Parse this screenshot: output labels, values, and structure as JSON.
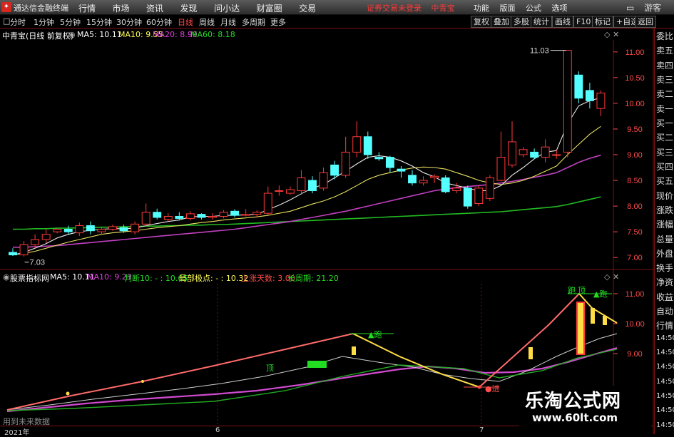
{
  "app": {
    "title": "通达信金融终端",
    "menu": [
      "行情",
      "市场",
      "资讯",
      "发现",
      "问小达",
      "财富圈",
      "交易"
    ],
    "notice": [
      "证券交易未登录",
      "中青宝"
    ],
    "right_menu": [
      "功能",
      "版面",
      "公式",
      "选项"
    ],
    "window_controls": [
      "游客"
    ]
  },
  "periods": {
    "items": [
      "分时",
      "1分钟",
      "5分钟",
      "15分钟",
      "30分钟",
      "60分钟",
      "日线",
      "周线",
      "月线",
      "多周期",
      "更多"
    ],
    "selected": "日线",
    "right_buttons": [
      "复权",
      "叠加",
      "多股",
      "统计",
      "画线",
      "F10",
      "标记",
      "+自选",
      "返回"
    ]
  },
  "main_chart": {
    "stock": "中青宝(日线 前复权)",
    "ma_labels": [
      {
        "text": "MA5: 10.11",
        "color": "#ffffff"
      },
      {
        "text": "MA10: 9.55",
        "color": "#ffff55"
      },
      {
        "text": "MA20: 8.99",
        "color": "#e040e0"
      },
      {
        "text": "MA60: 8.18",
        "color": "#22dd22"
      }
    ],
    "high_label": "11.03",
    "low_label": "7.03"
  },
  "sub_chart": {
    "indicator": "股票指标网",
    "labels": [
      {
        "text": "MA5: 10.11",
        "color": "#ffffff"
      },
      {
        "text": "MA10: 9.23",
        "color": "#e040e0"
      },
      {
        "text": "判断10: - : 10.65",
        "color": "#22dd22"
      },
      {
        "text": "局部极点: - : 10.32",
        "color": "#ffff55"
      },
      {
        "text": "上涨天数: 3.00",
        "color": "#ff4b4b"
      },
      {
        "text": "长周期: 21.20",
        "color": "#22dd22"
      }
    ],
    "marks": [
      {
        "text": "顶",
        "color": "#22dd22"
      },
      {
        "text": "▲跑",
        "color": "#22dd22"
      },
      {
        "text": "顶",
        "color": "#22dd22"
      },
      {
        "text": "跑",
        "color": "#22dd22"
      },
      {
        "text": "▲跑",
        "color": "#22dd22"
      },
      {
        "text": "●进",
        "color": "#ff4b4b"
      }
    ],
    "note": "用到未来数据"
  },
  "right_panel": {
    "items": [
      "委比",
      "卖五",
      "卖四",
      "卖三",
      "卖二",
      "卖一",
      "买一",
      "买二",
      "买三",
      "买四",
      "买五",
      "现价",
      "涨跌",
      "涨幅",
      "总量",
      "外盘",
      "换手",
      "净资",
      "收益",
      "自动",
      "行情",
      "14:50",
      "14:50",
      "14:50",
      "14:50",
      "14:50",
      "14:50",
      "14:50"
    ]
  },
  "dates": [
    "2021年",
    "6",
    "7"
  ],
  "watermark": {
    "line1": "乐淘公式网",
    "line2": "www.60lt.com"
  },
  "chart_data": {
    "type": "candlestick",
    "title": "中青宝(日线 前复权)",
    "ylim": [
      6.85,
      11.15
    ],
    "y_ticks": [
      7.0,
      7.5,
      8.0,
      8.5,
      9.0,
      9.5,
      10.0,
      10.5,
      11.0
    ],
    "candles": [
      {
        "o": 7.1,
        "c": 7.05,
        "h": 7.18,
        "l": 7.03
      },
      {
        "o": 7.05,
        "c": 7.25,
        "h": 7.32,
        "l": 7.02
      },
      {
        "o": 7.25,
        "c": 7.35,
        "h": 7.45,
        "l": 7.18
      },
      {
        "o": 7.35,
        "c": 7.45,
        "h": 7.55,
        "l": 7.28
      },
      {
        "o": 7.5,
        "c": 7.55,
        "h": 7.58,
        "l": 7.47
      },
      {
        "o": 7.55,
        "c": 7.5,
        "h": 7.62,
        "l": 7.45
      },
      {
        "o": 7.48,
        "c": 7.62,
        "h": 7.68,
        "l": 7.42
      },
      {
        "o": 7.62,
        "c": 7.52,
        "h": 7.7,
        "l": 7.45
      },
      {
        "o": 7.5,
        "c": 7.55,
        "h": 7.6,
        "l": 7.45
      },
      {
        "o": 7.55,
        "c": 7.6,
        "h": 7.64,
        "l": 7.52
      },
      {
        "o": 7.58,
        "c": 7.52,
        "h": 7.64,
        "l": 7.48
      },
      {
        "o": 7.5,
        "c": 7.65,
        "h": 7.7,
        "l": 7.45
      },
      {
        "o": 7.65,
        "c": 7.88,
        "h": 8.05,
        "l": 7.6
      },
      {
        "o": 7.88,
        "c": 7.78,
        "h": 7.95,
        "l": 7.74
      },
      {
        "o": 7.74,
        "c": 7.8,
        "h": 7.86,
        "l": 7.7
      },
      {
        "o": 7.8,
        "c": 7.76,
        "h": 7.88,
        "l": 7.72
      },
      {
        "o": 7.76,
        "c": 7.85,
        "h": 7.9,
        "l": 7.72
      },
      {
        "o": 7.84,
        "c": 7.78,
        "h": 7.86,
        "l": 7.74
      },
      {
        "o": 7.78,
        "c": 7.8,
        "h": 7.86,
        "l": 7.74
      },
      {
        "o": 7.8,
        "c": 7.88,
        "h": 7.92,
        "l": 7.76
      },
      {
        "o": 7.9,
        "c": 7.82,
        "h": 7.94,
        "l": 7.78
      },
      {
        "o": 7.82,
        "c": 7.84,
        "h": 7.94,
        "l": 7.8
      },
      {
        "o": 7.84,
        "c": 7.88,
        "h": 7.92,
        "l": 7.78
      },
      {
        "o": 7.86,
        "c": 8.25,
        "h": 8.38,
        "l": 7.82
      },
      {
        "o": 8.3,
        "c": 8.3,
        "h": 8.4,
        "l": 8.2
      },
      {
        "o": 8.25,
        "c": 8.32,
        "h": 8.38,
        "l": 8.22
      },
      {
        "o": 8.3,
        "c": 8.55,
        "h": 8.7,
        "l": 8.22
      },
      {
        "o": 8.5,
        "c": 8.3,
        "h": 8.58,
        "l": 8.25
      },
      {
        "o": 8.35,
        "c": 8.65,
        "h": 8.75,
        "l": 8.3
      },
      {
        "o": 8.8,
        "c": 8.6,
        "h": 8.88,
        "l": 8.52
      },
      {
        "o": 8.6,
        "c": 9.05,
        "h": 9.35,
        "l": 8.55
      },
      {
        "o": 9.05,
        "c": 9.35,
        "h": 9.65,
        "l": 8.95
      },
      {
        "o": 9.35,
        "c": 9.0,
        "h": 9.45,
        "l": 8.92
      },
      {
        "o": 8.95,
        "c": 8.92,
        "h": 9.05,
        "l": 8.88
      },
      {
        "o": 8.95,
        "c": 8.75,
        "h": 8.98,
        "l": 8.65
      },
      {
        "o": 8.72,
        "c": 8.68,
        "h": 8.78,
        "l": 8.55
      },
      {
        "o": 8.6,
        "c": 8.45,
        "h": 8.7,
        "l": 8.4
      },
      {
        "o": 8.45,
        "c": 8.5,
        "h": 8.58,
        "l": 8.4
      },
      {
        "o": 8.55,
        "c": 8.58,
        "h": 8.62,
        "l": 8.45
      },
      {
        "o": 8.55,
        "c": 8.28,
        "h": 8.6,
        "l": 8.25
      },
      {
        "o": 8.3,
        "c": 8.35,
        "h": 8.45,
        "l": 8.25
      },
      {
        "o": 8.35,
        "c": 8.0,
        "h": 8.4,
        "l": 7.95
      },
      {
        "o": 8.05,
        "c": 8.35,
        "h": 8.4,
        "l": 8.0
      },
      {
        "o": 8.15,
        "c": 8.55,
        "h": 8.6,
        "l": 8.1
      },
      {
        "o": 8.5,
        "c": 8.95,
        "h": 9.45,
        "l": 8.48
      },
      {
        "o": 8.8,
        "c": 9.25,
        "h": 9.65,
        "l": 8.75
      },
      {
        "o": 9.0,
        "c": 9.1,
        "h": 9.15,
        "l": 8.95
      },
      {
        "o": 9.05,
        "c": 8.95,
        "h": 9.12,
        "l": 8.92
      },
      {
        "o": 8.95,
        "c": 9.15,
        "h": 9.3,
        "l": 8.85
      },
      {
        "o": 9.0,
        "c": 9.0,
        "h": 9.1,
        "l": 8.92
      },
      {
        "o": 9.05,
        "c": 11.03,
        "h": 11.03,
        "l": 8.95
      },
      {
        "o": 10.55,
        "c": 10.1,
        "h": 10.62,
        "l": 10.0
      },
      {
        "o": 10.25,
        "c": 10.05,
        "h": 10.4,
        "l": 9.9
      },
      {
        "o": 9.9,
        "c": 10.2,
        "h": 10.25,
        "l": 9.75
      }
    ],
    "ma5": [
      7.05,
      7.1,
      7.18,
      7.27,
      7.38,
      7.45,
      7.5,
      7.53,
      7.55,
      7.56,
      7.56,
      7.57,
      7.62,
      7.66,
      7.7,
      7.73,
      7.79,
      7.8,
      7.8,
      7.82,
      7.82,
      7.83,
      7.84,
      7.93,
      8.02,
      8.12,
      8.24,
      8.35,
      8.42,
      8.55,
      8.68,
      8.82,
      8.95,
      8.98,
      8.95,
      8.88,
      8.78,
      8.65,
      8.57,
      8.45,
      8.4,
      8.35,
      8.3,
      8.3,
      8.4,
      8.6,
      8.75,
      8.92,
      9.05,
      9.08,
      9.6,
      9.95,
      10.05,
      10.11
    ],
    "ma10": [
      7.05,
      7.08,
      7.12,
      7.18,
      7.24,
      7.3,
      7.35,
      7.4,
      7.45,
      7.48,
      7.5,
      7.52,
      7.55,
      7.58,
      7.6,
      7.62,
      7.65,
      7.68,
      7.7,
      7.73,
      7.75,
      7.77,
      7.79,
      7.82,
      7.86,
      7.9,
      7.97,
      8.04,
      8.1,
      8.18,
      8.28,
      8.4,
      8.52,
      8.6,
      8.65,
      8.7,
      8.74,
      8.76,
      8.75,
      8.72,
      8.65,
      8.58,
      8.5,
      8.45,
      8.42,
      8.45,
      8.5,
      8.58,
      8.68,
      8.78,
      9.0,
      9.2,
      9.4,
      9.55
    ],
    "ma20": [
      7.2,
      7.2,
      7.21,
      7.22,
      7.23,
      7.25,
      7.27,
      7.29,
      7.31,
      7.33,
      7.35,
      7.37,
      7.39,
      7.41,
      7.43,
      7.45,
      7.47,
      7.49,
      7.51,
      7.53,
      7.55,
      7.58,
      7.61,
      7.64,
      7.67,
      7.7,
      7.74,
      7.78,
      7.82,
      7.86,
      7.9,
      7.95,
      8.0,
      8.05,
      8.1,
      8.15,
      8.2,
      8.25,
      8.3,
      8.33,
      8.36,
      8.38,
      8.4,
      8.42,
      8.45,
      8.48,
      8.52,
      8.56,
      8.6,
      8.65,
      8.75,
      8.85,
      8.93,
      8.99
    ],
    "ma60": [
      7.55,
      7.55,
      7.56,
      7.56,
      7.57,
      7.57,
      7.58,
      7.58,
      7.59,
      7.59,
      7.6,
      7.6,
      7.61,
      7.61,
      7.62,
      7.62,
      7.63,
      7.63,
      7.64,
      7.64,
      7.65,
      7.66,
      7.67,
      7.68,
      7.69,
      7.7,
      7.71,
      7.72,
      7.73,
      7.74,
      7.75,
      7.76,
      7.77,
      7.78,
      7.79,
      7.8,
      7.81,
      7.82,
      7.83,
      7.84,
      7.85,
      7.86,
      7.87,
      7.88,
      7.89,
      7.91,
      7.93,
      7.95,
      7.97,
      7.99,
      8.03,
      8.08,
      8.13,
      8.18
    ]
  }
}
